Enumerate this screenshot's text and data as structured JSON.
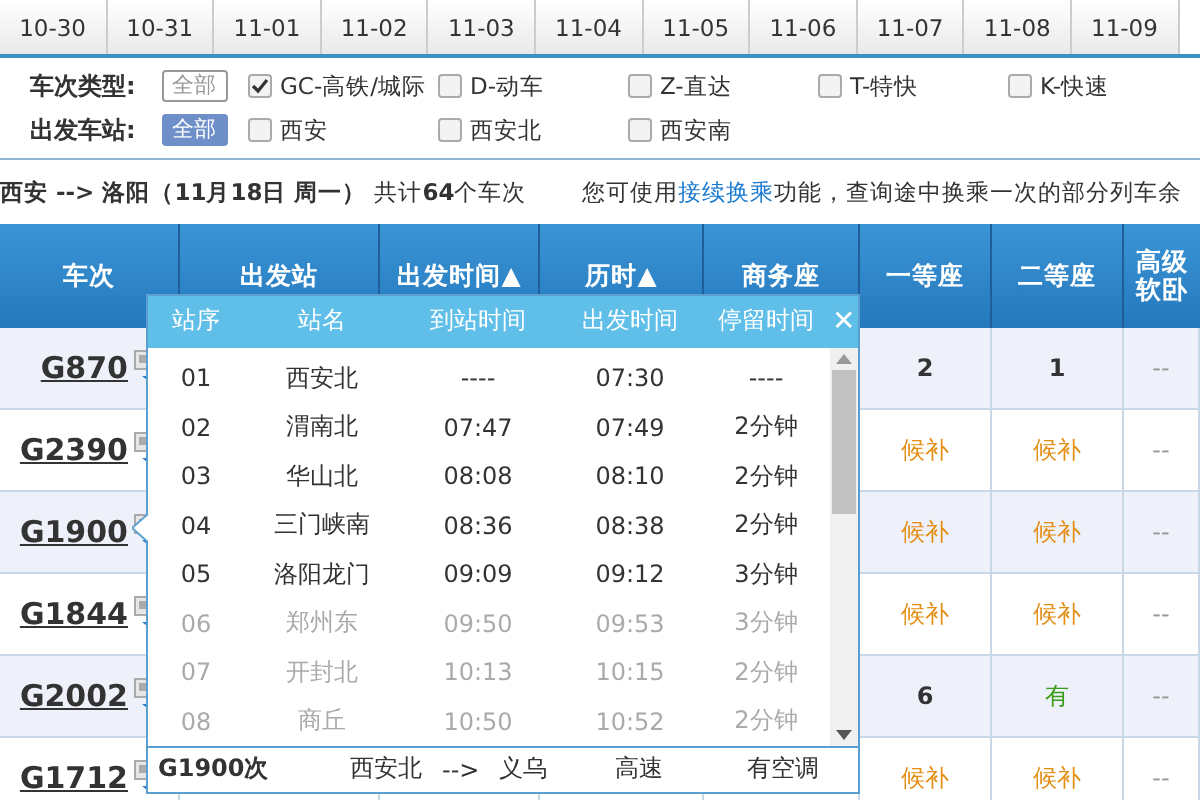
{
  "date_tabs": [
    {
      "label": "10-30",
      "selected": false
    },
    {
      "label": "10-31",
      "selected": false
    },
    {
      "label": "11-01",
      "selected": false
    },
    {
      "label": "11-02",
      "selected": false
    },
    {
      "label": "11-03",
      "selected": false
    },
    {
      "label": "11-04",
      "selected": false
    },
    {
      "label": "11-05",
      "selected": false
    },
    {
      "label": "11-06",
      "selected": false
    },
    {
      "label": "11-07",
      "selected": false
    },
    {
      "label": "11-08",
      "selected": false
    },
    {
      "label": "11-09",
      "selected": false
    }
  ],
  "filters": [
    {
      "label": "车次类型:",
      "all": {
        "label": "全部",
        "selected": false
      },
      "options": [
        {
          "label": "GC-高铁/城际",
          "checked": true
        },
        {
          "label": "D-动车",
          "checked": false
        },
        {
          "label": "Z-直达",
          "checked": false
        },
        {
          "label": "T-特快",
          "checked": false
        },
        {
          "label": "K-快速",
          "checked": false
        }
      ]
    },
    {
      "label": "出发车站:",
      "all": {
        "label": "全部",
        "selected": true
      },
      "options": [
        {
          "label": "西安",
          "checked": false
        },
        {
          "label": "西安北",
          "checked": false
        },
        {
          "label": "西安南",
          "checked": false
        }
      ]
    }
  ],
  "summary": {
    "route": "西安 --> 洛阳（11月18日  周一）",
    "count": "共计**64**个车次",
    "tip_before": "您可使用",
    "tip_link": "接续换乘",
    "tip_after": "功能，查询途中换乘一次的部分列车余"
  },
  "table": {
    "columns": [
      "车次",
      "出发站",
      "出发时间▲",
      "历时▲",
      "商务座",
      "一等座",
      "二等座",
      "高级软卧"
    ],
    "rows": [
      {
        "train": "G870",
        "seats": [
          {
            "kind": "count",
            "text": "2"
          },
          {
            "kind": "count",
            "text": "1"
          },
          {
            "kind": "none",
            "text": "--"
          }
        ]
      },
      {
        "train": "G2390",
        "seats": [
          {
            "kind": "waitlist",
            "text": "候补"
          },
          {
            "kind": "waitlist",
            "text": "候补"
          },
          {
            "kind": "none",
            "text": "--"
          }
        ]
      },
      {
        "train": "G1900",
        "seats": [
          {
            "kind": "waitlist",
            "text": "候补"
          },
          {
            "kind": "waitlist",
            "text": "候补"
          },
          {
            "kind": "none",
            "text": "--"
          }
        ]
      },
      {
        "train": "G1844",
        "seats": [
          {
            "kind": "waitlist",
            "text": "候补"
          },
          {
            "kind": "waitlist",
            "text": "候补"
          },
          {
            "kind": "none",
            "text": "--"
          }
        ]
      },
      {
        "train": "G2002",
        "seats": [
          {
            "kind": "count",
            "text": "6"
          },
          {
            "kind": "available",
            "text": "有"
          },
          {
            "kind": "none",
            "text": "--"
          }
        ]
      },
      {
        "train": "G1712",
        "seats": [
          {
            "kind": "waitlist",
            "text": "候补"
          },
          {
            "kind": "waitlist",
            "text": "候补"
          },
          {
            "kind": "none",
            "text": "--"
          }
        ]
      }
    ]
  },
  "stops_popup": {
    "columns": [
      "站序",
      "站名",
      "到站时间",
      "出发时间",
      "停留时间"
    ],
    "close": "✕",
    "stops": [
      {
        "no": "01",
        "station": "西安北",
        "arrive": "----",
        "depart": "07:30",
        "stay": "----",
        "in_segment": true
      },
      {
        "no": "02",
        "station": "渭南北",
        "arrive": "07:47",
        "depart": "07:49",
        "stay": "2分钟",
        "in_segment": true
      },
      {
        "no": "03",
        "station": "华山北",
        "arrive": "08:08",
        "depart": "08:10",
        "stay": "2分钟",
        "in_segment": true
      },
      {
        "no": "04",
        "station": "三门峡南",
        "arrive": "08:36",
        "depart": "08:38",
        "stay": "2分钟",
        "in_segment": true
      },
      {
        "no": "05",
        "station": "洛阳龙门",
        "arrive": "09:09",
        "depart": "09:12",
        "stay": "3分钟",
        "in_segment": true
      },
      {
        "no": "06",
        "station": "郑州东",
        "arrive": "09:50",
        "depart": "09:53",
        "stay": "3分钟",
        "in_segment": false
      },
      {
        "no": "07",
        "station": "开封北",
        "arrive": "10:13",
        "depart": "10:15",
        "stay": "2分钟",
        "in_segment": false
      },
      {
        "no": "08",
        "station": "商丘",
        "arrive": "10:50",
        "depart": "10:52",
        "stay": "2分钟",
        "in_segment": false
      }
    ],
    "footer": {
      "train": "G1900次",
      "from": "西安北",
      "arrow": "-->",
      "to": "义乌",
      "type": "高速",
      "aircon": "有空调"
    }
  }
}
